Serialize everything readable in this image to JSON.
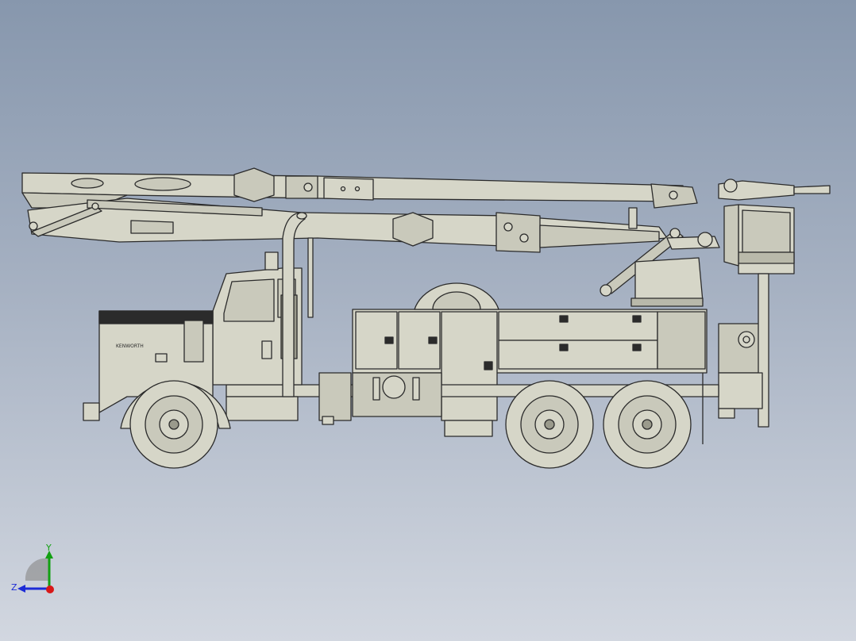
{
  "view": {
    "background_top": "#8797ad",
    "background_bottom": "#d2d7e0",
    "model_fill": "#d6d6c8",
    "model_shade": "#b9b9aa",
    "edge_color": "#2b2b2b"
  },
  "truck": {
    "door_emblem": "KENWORTH"
  },
  "triad": {
    "y_axis": "Y",
    "z_axis": "Z",
    "y_color": "#12a012",
    "z_color": "#1c2bd6",
    "x_color": "#d81818"
  }
}
